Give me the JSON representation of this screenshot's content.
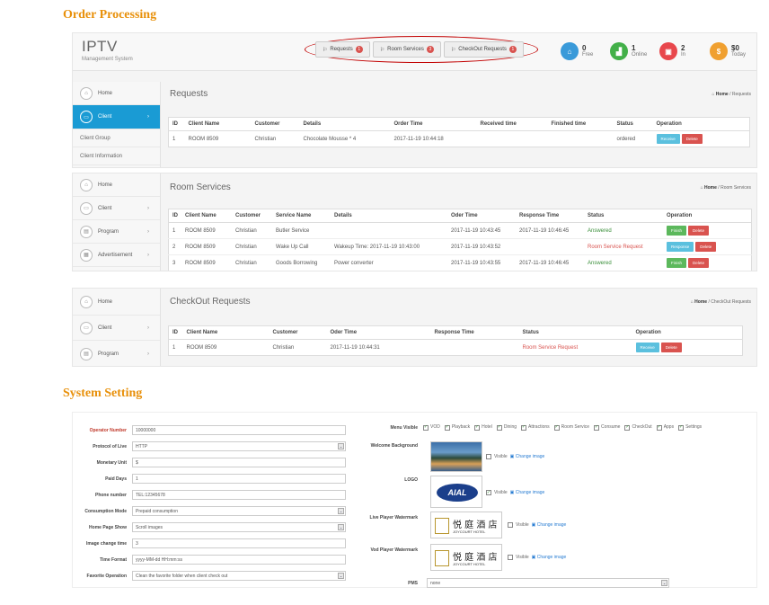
{
  "sections": {
    "order_processing": "Order Processing",
    "system_setting": "System Setting"
  },
  "brand": {
    "title": "IPTV",
    "subtitle": "Management System"
  },
  "top_buttons": [
    {
      "label": "Requests",
      "badge": "1"
    },
    {
      "label": "Room Services",
      "badge": "3"
    },
    {
      "label": "CheckOut Requests",
      "badge": "1"
    }
  ],
  "stats": [
    {
      "value": "0",
      "label": "Free",
      "color": "#3a9ad9"
    },
    {
      "value": "1",
      "label": "Online",
      "color": "#43b049"
    },
    {
      "value": "2",
      "label": "In",
      "color": "#e8474c"
    },
    {
      "value": "$0",
      "label": "Today",
      "color": "#f0a030"
    }
  ],
  "sidebar": {
    "home": "Home",
    "client": "Client",
    "client_group": "Client Group",
    "client_info": "Client Information",
    "program": "Program",
    "advertisement": "Advertisement"
  },
  "requests": {
    "title": "Requests",
    "crumb_home": "Home",
    "crumb_page": "Requests",
    "columns": [
      "ID",
      "Client Name",
      "Customer",
      "Details",
      "Order Time",
      "Received time",
      "Finished time",
      "Status",
      "Operation"
    ],
    "rows": [
      {
        "id": "1",
        "client": "ROOM 8509",
        "customer": "Christian",
        "details": "Chocolate Mousse * 4",
        "order_time": "2017-11-19 10:44:18",
        "received": "",
        "finished": "",
        "status": "ordered"
      }
    ],
    "btn_receive": "Receive",
    "btn_delete": "Delete"
  },
  "room_services": {
    "title": "Room Services",
    "crumb_home": "Home",
    "crumb_page": "Room Services",
    "columns": [
      "ID",
      "Client Name",
      "Customer",
      "Service Name",
      "Details",
      "Oder Time",
      "Response Time",
      "Status",
      "Operation"
    ],
    "rows": [
      {
        "id": "1",
        "client": "ROOM 8509",
        "customer": "Christian",
        "service": "Butler Service",
        "details": "",
        "order_time": "2017-11-19 10:43:45",
        "response": "2017-11-19 10:46:45",
        "status": "Answered",
        "b1": "Finish",
        "b2": "Delete"
      },
      {
        "id": "2",
        "client": "ROOM 8509",
        "customer": "Christian",
        "service": "Wake Up Call",
        "details": "Wakeup Time: 2017-11-19 10:43:00",
        "order_time": "2017-11-19 10:43:52",
        "response": "",
        "status": "Room Service Request",
        "b1": "Response",
        "b2": "Delete"
      },
      {
        "id": "3",
        "client": "ROOM 8509",
        "customer": "Christian",
        "service": "Goods Borrowing",
        "details": "Power converter",
        "order_time": "2017-11-19 10:43:55",
        "response": "2017-11-19 10:46:45",
        "status": "Answered",
        "b1": "Finish",
        "b2": "Delete"
      }
    ]
  },
  "checkout": {
    "title": "CheckOut Requests",
    "crumb_home": "Home",
    "crumb_page": "CheckOut Requests",
    "columns": [
      "ID",
      "Client Name",
      "Customer",
      "Oder Time",
      "Response Time",
      "Status",
      "Operation"
    ],
    "rows": [
      {
        "id": "1",
        "client": "ROOM 8509",
        "customer": "Christian",
        "order_time": "2017-11-19 10:44:31",
        "response": "",
        "status": "Room Service Request"
      }
    ],
    "btn_receive": "Receive",
    "btn_delete": "Delete"
  },
  "settings": {
    "fields": [
      {
        "label": "Operator Number",
        "value": "10000000",
        "dropdown": false,
        "required": true
      },
      {
        "label": "Protocol of Live",
        "value": "HTTP",
        "dropdown": true,
        "required": false
      },
      {
        "label": "Monetary Unit",
        "value": "$",
        "dropdown": false,
        "required": false
      },
      {
        "label": "Paid Days",
        "value": "1",
        "dropdown": false,
        "required": false
      },
      {
        "label": "Phone number",
        "value": "TEL:12345678",
        "dropdown": false,
        "required": false
      },
      {
        "label": "Consumption Mode",
        "value": "Prepaid consumption",
        "dropdown": true,
        "required": false
      },
      {
        "label": "Home Page Show",
        "value": "Scroll images",
        "dropdown": true,
        "required": false
      },
      {
        "label": "Image change time",
        "value": "3",
        "dropdown": false,
        "required": false
      },
      {
        "label": "Time Format",
        "value": "yyyy-MM-dd HH:mm:ss",
        "dropdown": false,
        "required": false
      },
      {
        "label": "Favorite Operation",
        "value": "Clean the favorite folder when client check out",
        "dropdown": true,
        "required": false
      }
    ],
    "menu_visible_label": "Menu Visible",
    "menu_items": [
      "VOD",
      "Playback",
      "Hotel",
      "Dining",
      "Attractions",
      "Room Service",
      "Consume",
      "CheckOut",
      "Apps",
      "Settings"
    ],
    "welcome_label": "Welcome Background",
    "logo_label": "LOGO",
    "logo_text": "AIAL",
    "live_wm_label": "Live Player Watermark",
    "vod_wm_label": "Vod Player Watermark",
    "hotel_cn": "悦 庭 酒 店",
    "hotel_en": "JOYCOURT HOTEL",
    "visible": "Visible",
    "change_image": "Change image",
    "pms_label": "PMS",
    "pms_value": "none"
  }
}
